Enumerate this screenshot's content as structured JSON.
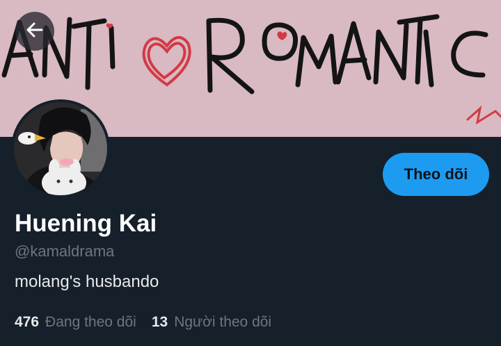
{
  "banner": {
    "text_left": "ANTI",
    "text_right": "ROMANTIC",
    "bg_color": "#d9b9c2",
    "heart_color": "#d23a44"
  },
  "header": {
    "back_icon": "arrow-left-icon"
  },
  "profile": {
    "name": "Huening Kai",
    "handle": "@kamaldrama",
    "bio": "molang's husbando",
    "follow_label": "Theo dõi"
  },
  "stats": {
    "following_count": "476",
    "following_label": "Đang theo dõi",
    "followers_count": "13",
    "followers_label": "Người theo dõi"
  },
  "colors": {
    "background": "#15202b",
    "accent": "#1d9bf0",
    "muted_text": "#6e767d"
  }
}
